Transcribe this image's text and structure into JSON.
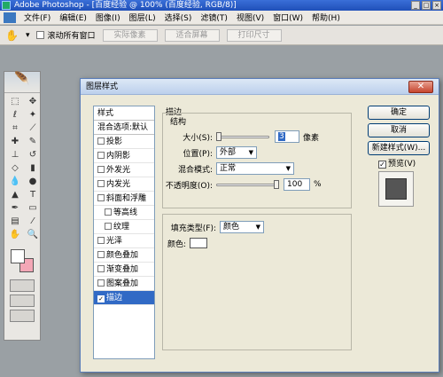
{
  "app": {
    "title": "Adobe Photoshop - [百度经验 @ 100% (百度经验, RGB/8)]"
  },
  "menu": [
    "文件(F)",
    "编辑(E)",
    "图像(I)",
    "图层(L)",
    "选择(S)",
    "滤镜(T)",
    "视图(V)",
    "窗口(W)",
    "帮助(H)"
  ],
  "options": {
    "scroll_all": "滚动所有窗口",
    "actual_pixels": "实际像素",
    "fit_screen": "适合屏幕",
    "print_size": "打印尺寸"
  },
  "dialog": {
    "title": "图层样式",
    "styles_header": "样式",
    "blend_default": "混合选项:默认",
    "effects": [
      {
        "label": "投影",
        "checked": false,
        "indent": false,
        "selected": false
      },
      {
        "label": "内阴影",
        "checked": false,
        "indent": false,
        "selected": false
      },
      {
        "label": "外发光",
        "checked": false,
        "indent": false,
        "selected": false
      },
      {
        "label": "内发光",
        "checked": false,
        "indent": false,
        "selected": false
      },
      {
        "label": "斜面和浮雕",
        "checked": false,
        "indent": false,
        "selected": false
      },
      {
        "label": "等高线",
        "checked": false,
        "indent": true,
        "selected": false
      },
      {
        "label": "纹理",
        "checked": false,
        "indent": true,
        "selected": false
      },
      {
        "label": "光泽",
        "checked": false,
        "indent": false,
        "selected": false
      },
      {
        "label": "颜色叠加",
        "checked": false,
        "indent": false,
        "selected": false
      },
      {
        "label": "渐变叠加",
        "checked": false,
        "indent": false,
        "selected": false
      },
      {
        "label": "图案叠加",
        "checked": false,
        "indent": false,
        "selected": false
      },
      {
        "label": "描边",
        "checked": true,
        "indent": false,
        "selected": true
      }
    ],
    "stroke": {
      "section": "描边",
      "structure": "结构",
      "size_label": "大小(S):",
      "size_value": "3",
      "size_unit": "像素",
      "position_label": "位置(P):",
      "position_value": "外部",
      "blend_label": "混合模式:",
      "blend_value": "正常",
      "opacity_label": "不透明度(O):",
      "opacity_value": "100",
      "opacity_unit": "%",
      "fill_type_label": "填充类型(F):",
      "fill_type_value": "颜色",
      "color_label": "颜色:",
      "color": "#ffffff"
    },
    "buttons": {
      "ok": "确定",
      "cancel": "取消",
      "new_style": "新建样式(W)...",
      "preview": "预览(V)"
    }
  }
}
